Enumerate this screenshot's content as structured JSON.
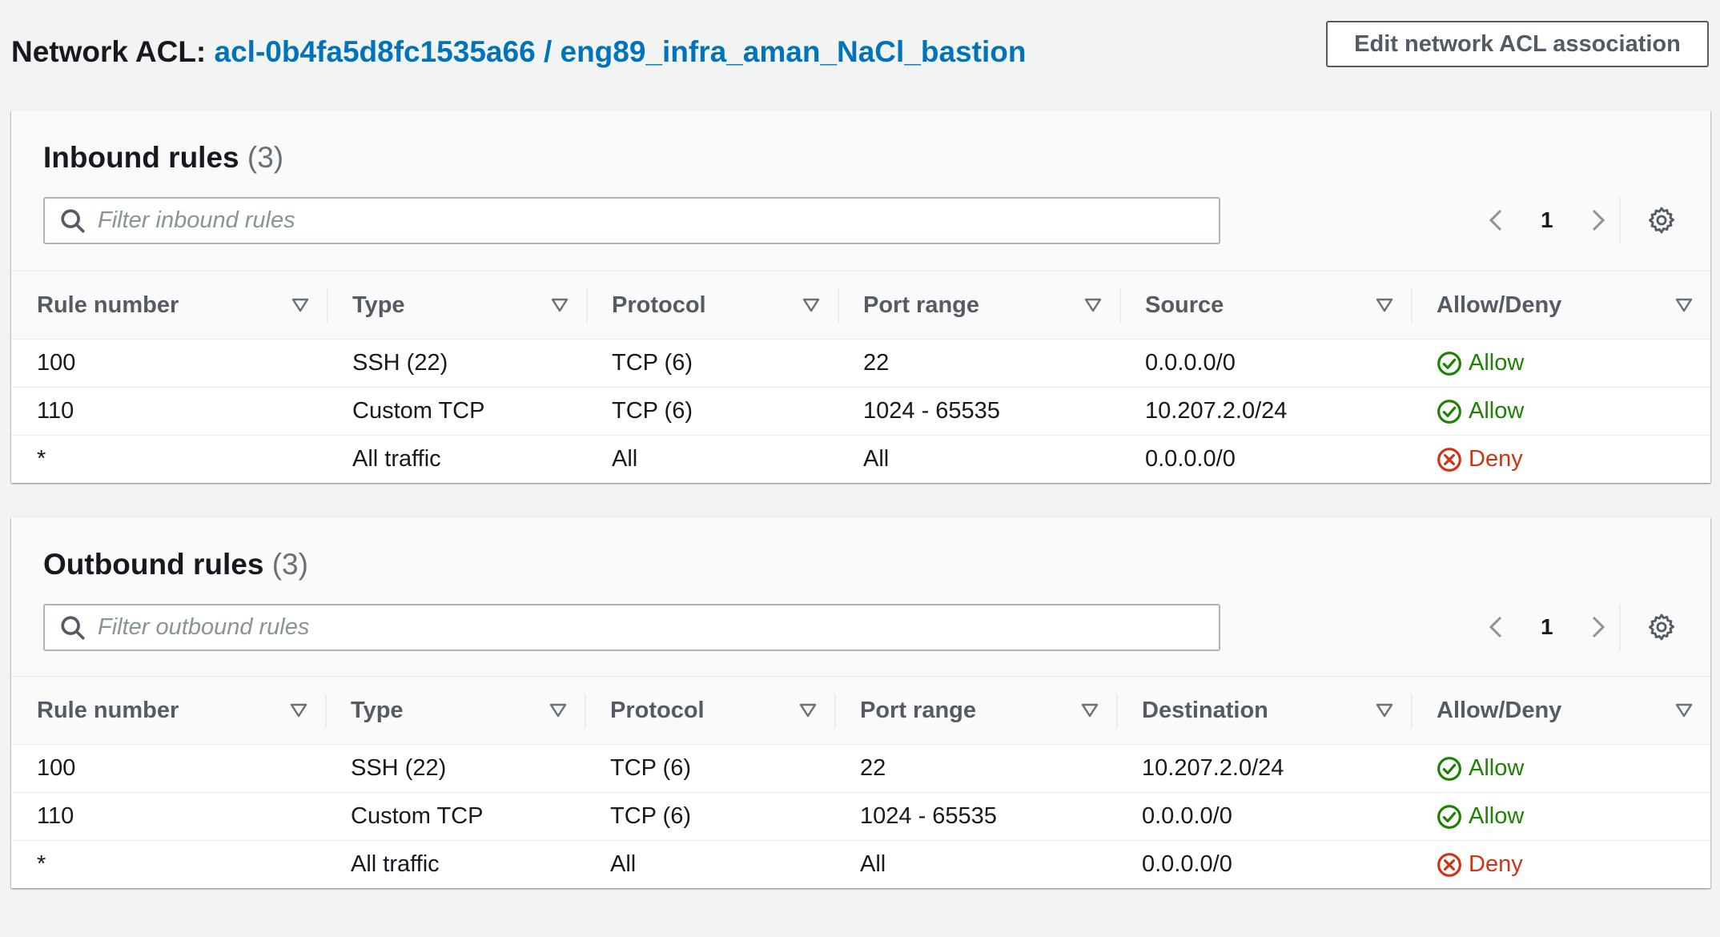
{
  "header": {
    "label": "Network ACL:",
    "acl_id": "acl-0b4fa5d8fc1535a66",
    "separator": "/",
    "acl_name": "eng89_infra_aman_NaCl_bastion",
    "edit_button": "Edit network ACL association"
  },
  "inbound": {
    "title": "Inbound rules",
    "count": "(3)",
    "filter_placeholder": "Filter inbound rules",
    "page": "1",
    "columns": [
      "Rule number",
      "Type",
      "Protocol",
      "Port range",
      "Source",
      "Allow/Deny"
    ],
    "rows": [
      {
        "rule": "100",
        "type": "SSH (22)",
        "protocol": "TCP (6)",
        "port": "22",
        "addr": "0.0.0.0/0",
        "action": "Allow"
      },
      {
        "rule": "110",
        "type": "Custom TCP",
        "protocol": "TCP (6)",
        "port": "1024 - 65535",
        "addr": "10.207.2.0/24",
        "action": "Allow"
      },
      {
        "rule": "*",
        "type": "All traffic",
        "protocol": "All",
        "port": "All",
        "addr": "0.0.0.0/0",
        "action": "Deny"
      }
    ]
  },
  "outbound": {
    "title": "Outbound rules",
    "count": "(3)",
    "filter_placeholder": "Filter outbound rules",
    "page": "1",
    "columns": [
      "Rule number",
      "Type",
      "Protocol",
      "Port range",
      "Destination",
      "Allow/Deny"
    ],
    "rows": [
      {
        "rule": "100",
        "type": "SSH (22)",
        "protocol": "TCP (6)",
        "port": "22",
        "addr": "10.207.2.0/24",
        "action": "Allow"
      },
      {
        "rule": "110",
        "type": "Custom TCP",
        "protocol": "TCP (6)",
        "port": "1024 - 65535",
        "addr": "0.0.0.0/0",
        "action": "Allow"
      },
      {
        "rule": "*",
        "type": "All traffic",
        "protocol": "All",
        "port": "All",
        "addr": "0.0.0.0/0",
        "action": "Deny"
      }
    ]
  },
  "icons": {
    "search": "search-icon",
    "prev": "chevron-left-icon",
    "next": "chevron-right-icon",
    "settings": "gear-icon",
    "sort": "sort-caret-icon",
    "allow": "check-circle-icon",
    "deny": "x-circle-icon"
  },
  "colors": {
    "link": "#0073bb",
    "allow": "#1d8102",
    "deny": "#d13212",
    "background": "#f2f3f3"
  }
}
